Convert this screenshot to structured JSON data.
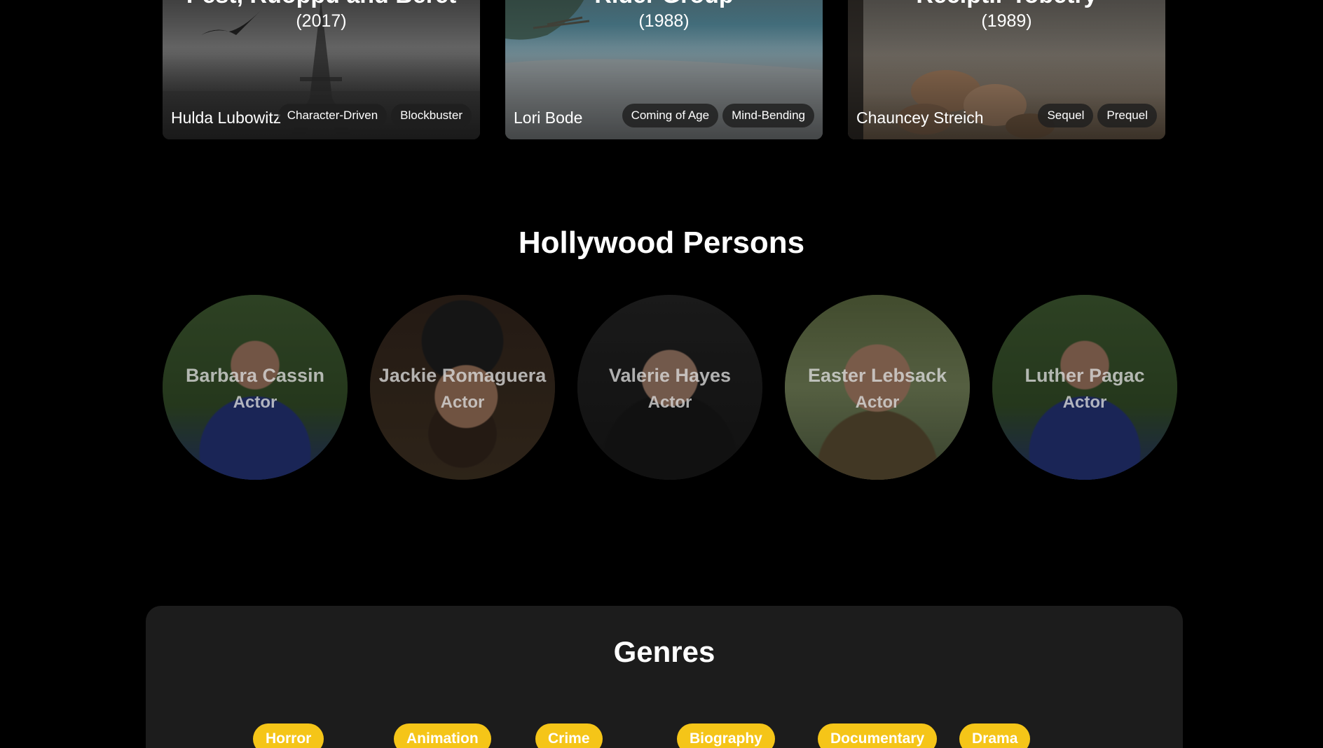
{
  "movies": [
    {
      "title": "Pest, Ruoppu and Beret",
      "year": "(2017)",
      "author": "Hulda Lubowitz",
      "tags": [
        "Character-Driven",
        "Blockbuster"
      ]
    },
    {
      "title": "Rider Group",
      "year": "(1988)",
      "author": "Lori Bode",
      "tags": [
        "Coming of Age",
        "Mind-Bending"
      ]
    },
    {
      "title": "Reciptir Tobetry",
      "year": "(1989)",
      "author": "Chauncey Streich",
      "tags": [
        "Sequel",
        "Prequel"
      ]
    }
  ],
  "persons_section": {
    "title": "Hollywood Persons",
    "persons": [
      {
        "name": "Barbara Cassin",
        "role": "Actor"
      },
      {
        "name": "Jackie Romaguera",
        "role": "Actor"
      },
      {
        "name": "Valerie Hayes",
        "role": "Actor"
      },
      {
        "name": "Easter Lebsack",
        "role": "Actor"
      },
      {
        "name": "Luther Pagac",
        "role": "Actor"
      }
    ]
  },
  "genres_section": {
    "title": "Genres",
    "genres": [
      "Horror",
      "Animation",
      "Crime",
      "Biography",
      "Documentary",
      "Drama"
    ]
  },
  "colors": {
    "background": "#000000",
    "panel": "#1c1c1c",
    "genre_chip": "#f5c518"
  }
}
